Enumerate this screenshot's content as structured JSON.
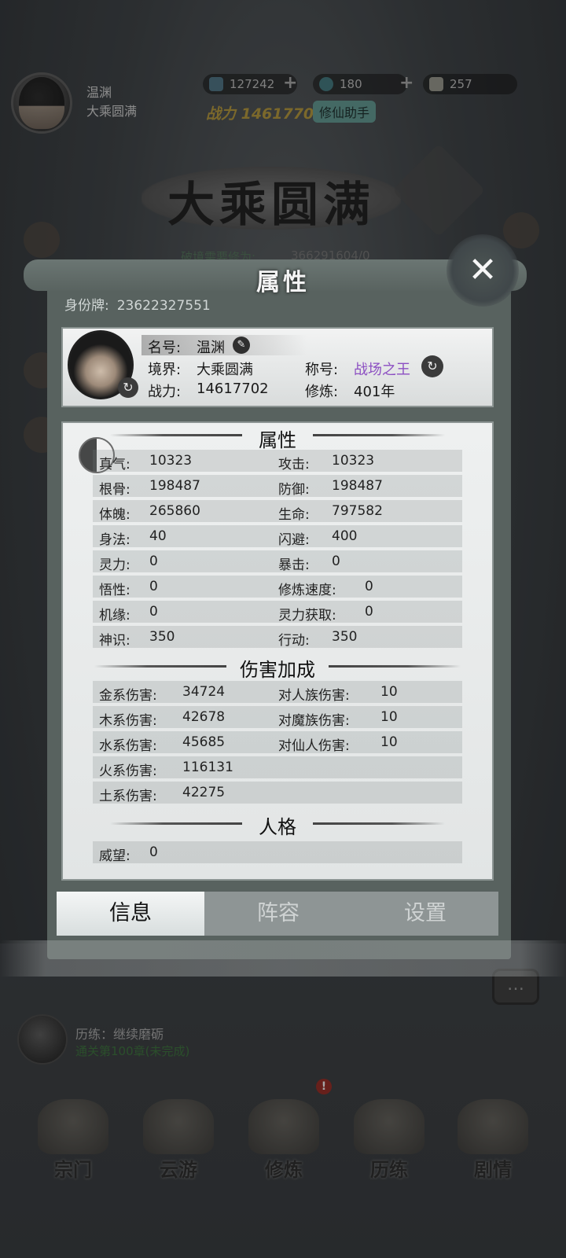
{
  "hud": {
    "player_name": "温渊",
    "player_realm": "大乘圆满",
    "resources": [
      {
        "icon": "spirit-stone-icon",
        "value": "127242"
      },
      {
        "icon": "jade-token-icon",
        "value": "180"
      },
      {
        "icon": "scroll-icon",
        "value": "257"
      }
    ],
    "plus": "+",
    "power_text": "战力 14617702",
    "helper_label": "修仙助手"
  },
  "background": {
    "realm_banner": "大乘圆满",
    "breakthrough_label": "破境需要修为:",
    "breakthrough_value": "366291604/0",
    "experience_title": "历练：继续磨砺",
    "experience_sub": "通关第100章(未完成)",
    "badge": "!",
    "chat_icon": "…"
  },
  "nav": [
    {
      "label": "宗门"
    },
    {
      "label": "云游"
    },
    {
      "label": "修炼"
    },
    {
      "label": "历练"
    },
    {
      "label": "剧情"
    }
  ],
  "dialog": {
    "title": "属性",
    "close_glyph": "✕",
    "id_label": "身份牌:",
    "id_value": "23622327551",
    "profile": {
      "name_label": "名号:",
      "name_value": "温渊",
      "realm_label": "境界:",
      "realm_value": "大乘圆满",
      "title_label": "称号:",
      "title_value": "战场之王",
      "power_label": "战力:",
      "power_value": "14617702",
      "cultivation_label": "修炼:",
      "cultivation_value": "401年",
      "edit_glyph": "✎",
      "swap_glyph": "↻"
    },
    "sections": {
      "attributes_title": "属性",
      "damage_title": "伤害加成",
      "personality_title": "人格"
    },
    "attributes": [
      {
        "l_label": "真气:",
        "l_value": "10323",
        "r_label": "攻击:",
        "r_value": "10323"
      },
      {
        "l_label": "根骨:",
        "l_value": "198487",
        "r_label": "防御:",
        "r_value": "198487"
      },
      {
        "l_label": "体魄:",
        "l_value": "265860",
        "r_label": "生命:",
        "r_value": "797582"
      },
      {
        "l_label": "身法:",
        "l_value": "40",
        "r_label": "闪避:",
        "r_value": "400"
      },
      {
        "l_label": "灵力:",
        "l_value": "0",
        "r_label": "暴击:",
        "r_value": "0"
      },
      {
        "l_label": "悟性:",
        "l_value": "0",
        "r_label": "修炼速度:",
        "r_value": "0"
      },
      {
        "l_label": "机缘:",
        "l_value": "0",
        "r_label": "灵力获取:",
        "r_value": "0"
      },
      {
        "l_label": "神识:",
        "l_value": "350",
        "r_label": "行动:",
        "r_value": "350"
      }
    ],
    "damage": [
      {
        "l_label": "金系伤害:",
        "l_value": "34724",
        "r_label": "对人族伤害:",
        "r_value": "10"
      },
      {
        "l_label": "木系伤害:",
        "l_value": "42678",
        "r_label": "对魔族伤害:",
        "r_value": "10"
      },
      {
        "l_label": "水系伤害:",
        "l_value": "45685",
        "r_label": "对仙人伤害:",
        "r_value": "10"
      },
      {
        "l_label": "火系伤害:",
        "l_value": "116131",
        "r_label": "",
        "r_value": ""
      },
      {
        "l_label": "土系伤害:",
        "l_value": "42275",
        "r_label": "",
        "r_value": ""
      }
    ],
    "personality": [
      {
        "l_label": "威望:",
        "l_value": "0"
      }
    ],
    "tabs": [
      {
        "label": "信息",
        "active": true
      },
      {
        "label": "阵容",
        "active": false
      },
      {
        "label": "设置",
        "active": false
      }
    ]
  },
  "colors": {
    "title_purple": "#8c4fc2",
    "dialog_frame": "#58625f"
  }
}
